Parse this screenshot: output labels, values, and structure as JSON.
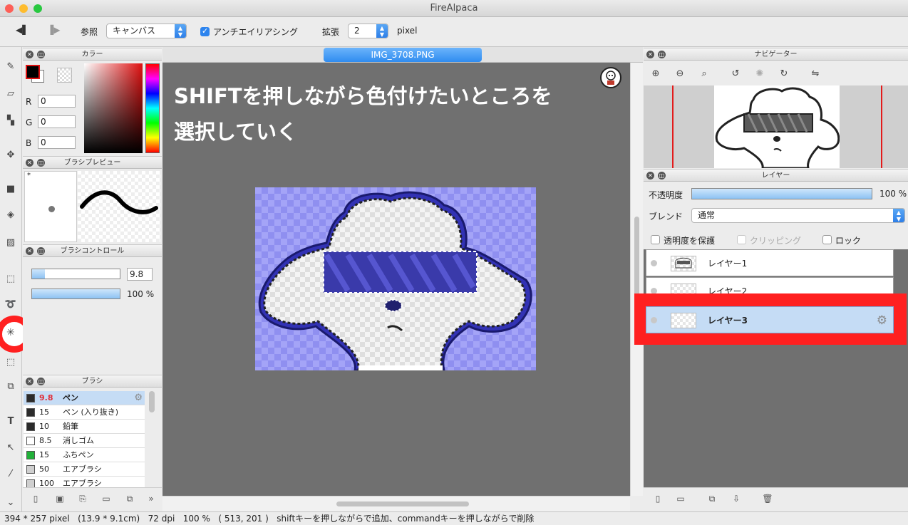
{
  "window": {
    "title": "FireAlpaca"
  },
  "toolbar": {
    "reference_label": "参照",
    "reference_value": "キャンバス",
    "antialias_label": "アンチエイリアシング",
    "expand_label": "拡張",
    "expand_value": "2",
    "expand_unit": "pixel"
  },
  "color_panel": {
    "title": "カラー",
    "r_label": "R",
    "r_value": "0",
    "g_label": "G",
    "g_value": "0",
    "b_label": "B",
    "b_value": "0",
    "foreground": "#000000",
    "background": "#ffffff"
  },
  "brush_preview": {
    "title": "ブラシプレビュー",
    "marker": "*"
  },
  "brush_control": {
    "title": "ブラシコントロール",
    "size_value": "9.8",
    "opacity_value": "100 %",
    "opacity_fraction": 1.0,
    "size_fraction": 0.15
  },
  "brush_panel": {
    "title": "ブラシ",
    "items": [
      {
        "size": "9.8",
        "name": "ペン",
        "color": "#2b2b2b",
        "selected": true
      },
      {
        "size": "15",
        "name": "ペン (入り抜き)",
        "color": "#2b2b2b"
      },
      {
        "size": "10",
        "name": "鉛筆",
        "color": "#2b2b2b"
      },
      {
        "size": "8.5",
        "name": "消しゴム",
        "color": "#ffffff"
      },
      {
        "size": "15",
        "name": "ふちペン",
        "color": "#22b13a"
      },
      {
        "size": "50",
        "name": "エアブラシ",
        "color": "#cfcfcf"
      },
      {
        "size": "100",
        "name": "エアブラシ",
        "color": "#cfcfcf"
      }
    ]
  },
  "document": {
    "tab_label": "IMG_3708.PNG",
    "caption_line1": "SHIFTを押しながら色付けたいところを",
    "caption_line2": "選択していく"
  },
  "navigator": {
    "title": "ナビゲーター"
  },
  "layer_panel": {
    "title": "レイヤー",
    "opacity_label": "不透明度",
    "opacity_value": "100 %",
    "opacity_fraction": 1.0,
    "blend_label": "ブレンド",
    "blend_value": "通常",
    "protect_alpha_label": "透明度を保護",
    "clipping_label": "クリッピング",
    "lock_label": "ロック",
    "layers": [
      {
        "name": "レイヤー1",
        "selected": false
      },
      {
        "name": "レイヤー2",
        "selected": false
      },
      {
        "name": "レイヤー3",
        "selected": true
      }
    ]
  },
  "status": {
    "size": "394 * 257 pixel",
    "cm": "(13.9 * 9.1cm)",
    "dpi": "72 dpi",
    "zoom": "100 %",
    "coords": "( 513, 201 )",
    "hint": "shiftキーを押しながらで追加、commandキーを押しながらで削除"
  },
  "colors": {
    "accent": "#2f8cf0",
    "highlight_red": "#ff2020",
    "selection_blue": "#c5dcf5"
  }
}
